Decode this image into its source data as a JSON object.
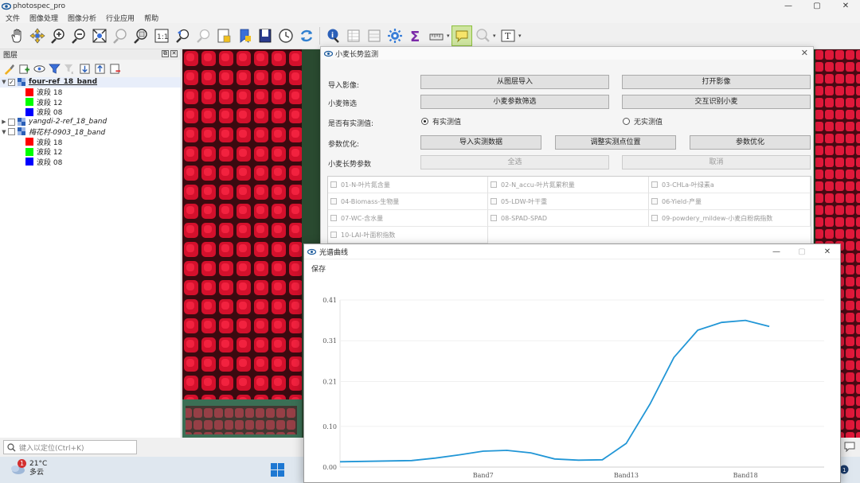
{
  "app": {
    "title": "photospec_pro"
  },
  "window_controls": {
    "minimize": "—",
    "maximize": "▢",
    "close": "✕"
  },
  "menu": [
    "文件",
    "图像处理",
    "图像分析",
    "行业应用",
    "帮助"
  ],
  "toolbar": {
    "icons": [
      "pan-icon",
      "pan-to-selection-icon",
      "zoom-in-icon",
      "zoom-out-icon",
      "zoom-full-icon",
      "zoom-to-selection-icon",
      "zoom-to-layer-icon",
      "zoom-native-icon",
      "zoom-last-icon",
      "zoom-next-icon",
      "new-bookmark-icon",
      "show-bookmarks-icon",
      "spatial-bookmark-icon",
      "temporal-controller-icon",
      "refresh-icon",
      "identify-icon",
      "attribute-table-icon",
      "statistics-icon",
      "settings-gear-icon",
      "sum-icon",
      "measure-icon",
      "map-tips-icon",
      "search-tool-icon",
      "text-annotation-icon"
    ]
  },
  "layers_panel": {
    "title": "图层",
    "float_btn": "⧉",
    "close_btn": "✕",
    "layers": [
      {
        "name": "four-ref_18_band",
        "expanded": true,
        "checked": true,
        "style": "bold",
        "bands": [
          {
            "label": "波段 18",
            "color": "#ff0000"
          },
          {
            "label": "波段 12",
            "color": "#00ff00"
          },
          {
            "label": "波段 08",
            "color": "#0000ff"
          }
        ]
      },
      {
        "name": "yangdi-2-ref_18_band",
        "expanded": false,
        "checked": false,
        "style": "italic",
        "bands": []
      },
      {
        "name": "梅花村-0903_18_band",
        "expanded": true,
        "checked": false,
        "style": "italic",
        "bands": [
          {
            "label": "波段 18",
            "color": "#ff0000"
          },
          {
            "label": "波段 12",
            "color": "#00ff00"
          },
          {
            "label": "波段 08",
            "color": "#0000ff"
          }
        ]
      }
    ]
  },
  "locator": {
    "placeholder": "键入以定位(Ctrl+K)"
  },
  "taskbar": {
    "temperature": "21°C",
    "weather": "多云",
    "badge": "1"
  },
  "wheat_dialog": {
    "title": "小麦长势监测",
    "close": "✕",
    "rows": {
      "import_label": "导入影像:",
      "import_from_layer": "从图层导入",
      "open_image": "打开影像",
      "filter_label": "小麦筛选",
      "param_filter": "小麦参数筛选",
      "interactive_identify": "交互识别小麦",
      "measured_label": "是否有实测值:",
      "radio_yes": "有实测值",
      "radio_no": "无实测值",
      "optimize_label": "参数优化:",
      "import_measured": "导入实测数据",
      "adjust_points": "调整实测点位置",
      "param_optimize": "参数优化",
      "growth_label": "小麦长势参数",
      "select_all": "全选",
      "cancel": "取消"
    },
    "params": [
      "01-N-叶片氮含量",
      "02-N_accu-叶片氮累积量",
      "03-CHLa-叶绿素a",
      "04-Biomass-生物量",
      "05-LDW-叶干重",
      "06-Yield-产量",
      "07-WC-含水量",
      "08-SPAD-SPAD",
      "09-powdery_mildew-小麦白粉病指数",
      "10-LAI-叶面积指数"
    ]
  },
  "spectrum_window": {
    "title": "光谱曲线",
    "save": "保存",
    "controls": {
      "minimize": "—",
      "maximize": "▢",
      "close": "✕"
    }
  },
  "chart_data": {
    "type": "line",
    "x": [
      1,
      2,
      3,
      4,
      5,
      6,
      7,
      8,
      9,
      10,
      11,
      12,
      13,
      14,
      15,
      16,
      17,
      18,
      19
    ],
    "series": [
      {
        "values": [
          0.013,
          0.014,
          0.015,
          0.016,
          0.022,
          0.03,
          0.039,
          0.041,
          0.035,
          0.02,
          0.017,
          0.018,
          0.058,
          0.155,
          0.269,
          0.336,
          0.355,
          0.36,
          0.345
        ]
      }
    ],
    "xticks": [
      {
        "x": 7,
        "label": "Band7"
      },
      {
        "x": 13,
        "label": "Band13"
      },
      {
        "x": 18,
        "label": "Band18"
      }
    ],
    "yticks": [
      0.0,
      0.1,
      0.21,
      0.31,
      0.41
    ],
    "ytick_labels": [
      "0.00",
      "0.10",
      "0.21",
      "0.31",
      "0.41"
    ],
    "xlim": [
      1,
      21.3
    ],
    "ylim": [
      0.0,
      0.41
    ],
    "line_color": "#2196d6",
    "title": "",
    "xlabel": "",
    "ylabel": ""
  }
}
